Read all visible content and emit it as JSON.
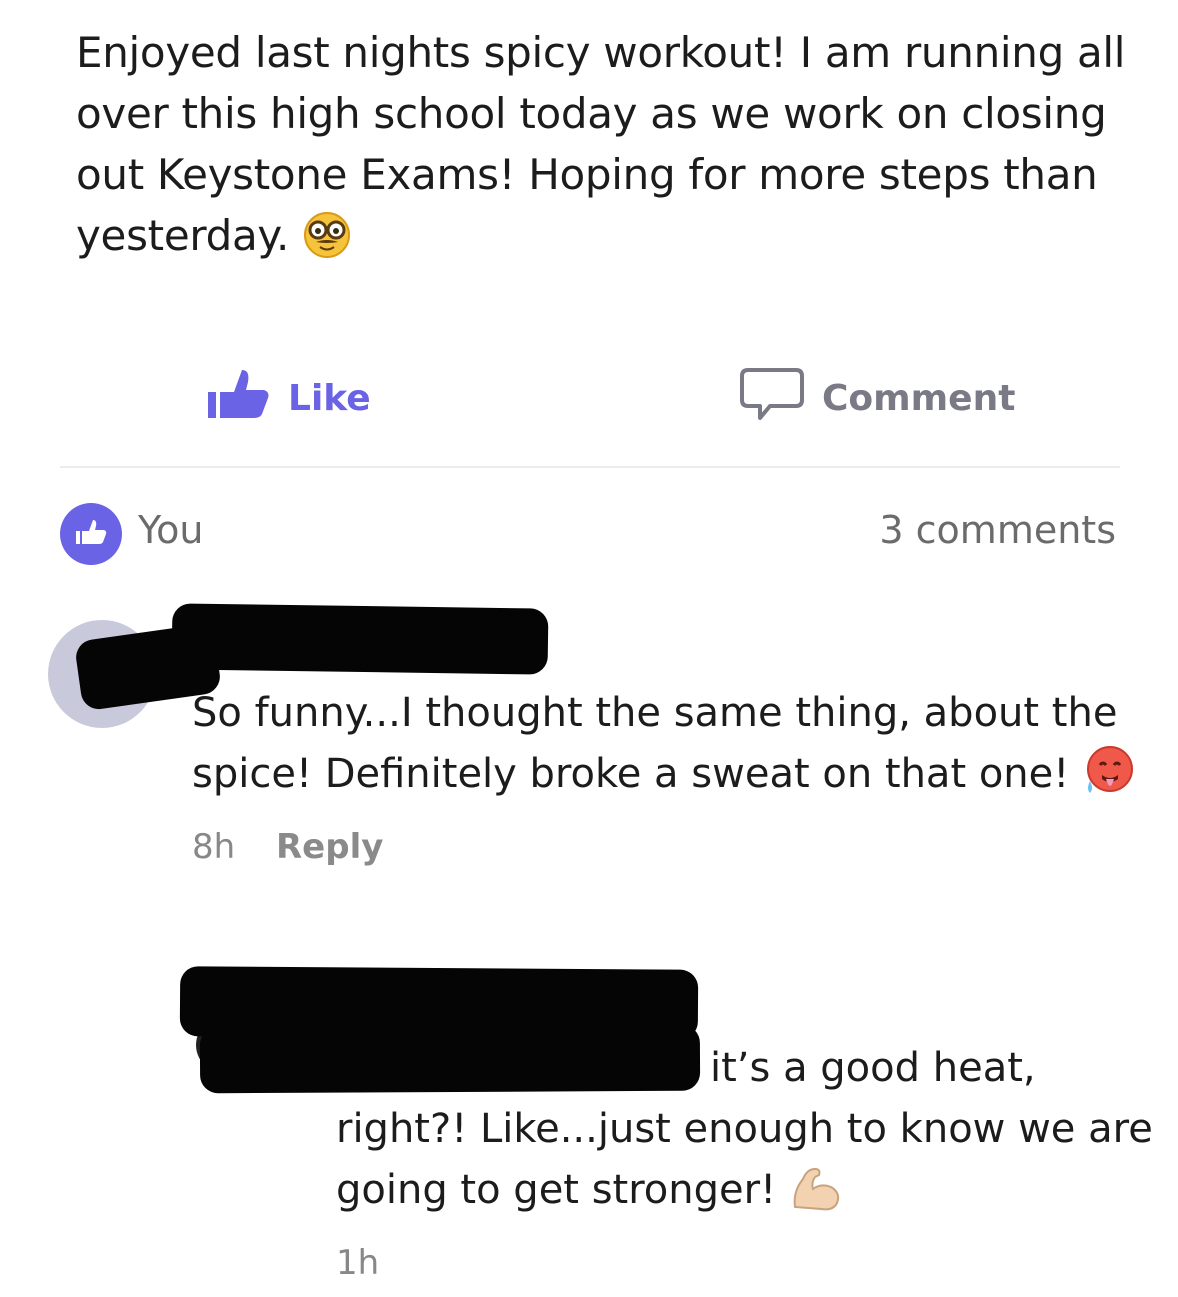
{
  "post": {
    "text": "Enjoyed last nights spicy workout! I am running all over this high school today as we work on closing out Keystone Exams! Hoping for more steps than yesterday.",
    "emoji": "nerd-glasses-emoji"
  },
  "actions": {
    "like_label": "Like",
    "comment_label": "Comment"
  },
  "reactions": {
    "you_label": "You",
    "comment_count": "3 comments"
  },
  "comments": [
    {
      "author": "",
      "text": "So funny...I thought the same thing, about the spice! Definitely broke a sweat on that one!",
      "emoji": "hot-face-emoji",
      "time": "8h",
      "reply_label": "Reply"
    },
    {
      "author": "",
      "text_line1": "it’s a good heat,",
      "text_rest": "right?! Like...just enough to know we are going to get stronger!",
      "emoji": "flexed-biceps-emoji",
      "time": "1h"
    }
  ],
  "colors": {
    "accent": "#6a63e6",
    "muted": "#7a7a87",
    "avatar": "#c9c9dc",
    "redaction": "#050505"
  }
}
